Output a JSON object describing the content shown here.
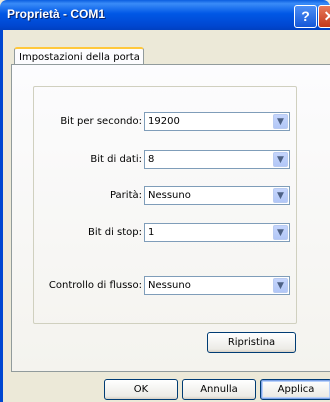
{
  "window": {
    "title": "Proprietà - COM1",
    "help_glyph": "?",
    "close_glyph": "✕"
  },
  "tabs": [
    {
      "label": "Impostazioni della porta"
    }
  ],
  "settings": [
    {
      "label": "Bit per secondo:",
      "value": "19200"
    },
    {
      "label": "Bit di dati:",
      "value": "8"
    },
    {
      "label": "Parità:",
      "value": "Nessuno"
    },
    {
      "label": "Bit di stop:",
      "value": "1"
    },
    {
      "label": "Controllo di flusso:",
      "value": "Nessuno"
    }
  ],
  "combo_arrow": "▼",
  "buttons": {
    "restore": "Ripristina",
    "ok": "OK",
    "cancel": "Annulla",
    "apply": "Applica"
  }
}
